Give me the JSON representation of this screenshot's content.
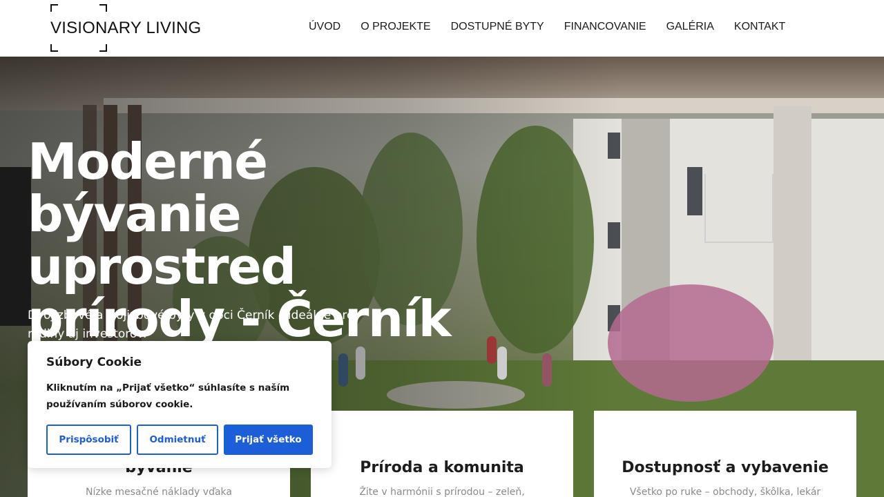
{
  "brand": {
    "logo_text": "VISIONARY LIVING"
  },
  "nav": {
    "items": [
      {
        "label": "ÚVOD"
      },
      {
        "label": "O PROJEKTE"
      },
      {
        "label": "DOSTUPNÉ BYTY"
      },
      {
        "label": "FINANCOVANIE"
      },
      {
        "label": "GALÉRIA"
      },
      {
        "label": "KONTAKT"
      }
    ]
  },
  "hero": {
    "title": "Moderné bývanie uprostred prírody - Černík",
    "subtitle": "Dvojizbové a trojizbové byty v obci Černík – ideálne pre rodiny aj investorov."
  },
  "features": [
    {
      "title": "bývanie",
      "text": "Nízke mesačné náklady vďaka"
    },
    {
      "title": "Príroda a komunita",
      "text": "Žite v harmónii s prírodou – zeleň,"
    },
    {
      "title": "Dostupnosť a vybavenie",
      "text": "Všetko po ruke – obchody, škôlka, lekár"
    }
  ],
  "cookie": {
    "title": "Súbory Cookie",
    "text": "Kliknutím na „Prijať všetko“ súhlasíte s naším používaním súborov cookie.",
    "customize_label": "Prispôsobiť",
    "reject_label": "Odmietnuť",
    "accept_label": "Prijať všetko"
  },
  "colors": {
    "accent": "#1b5ed8",
    "header_bg": "#ffffff",
    "text_dark": "#1b1b1b"
  }
}
